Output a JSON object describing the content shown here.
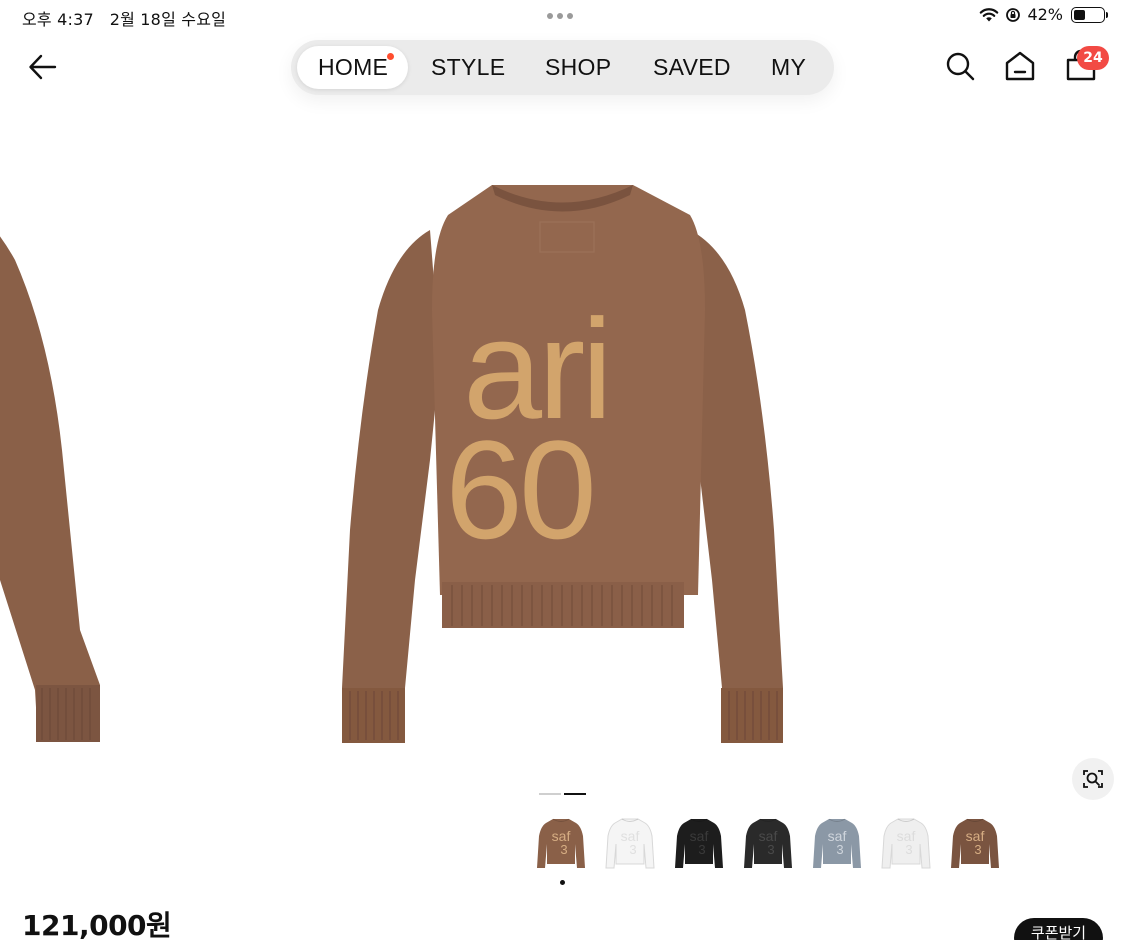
{
  "status_bar": {
    "time": "오후 4:37",
    "date": "2월 18일 수요일",
    "battery": "42%",
    "battery_level": 0.42
  },
  "nav": {
    "tabs": [
      {
        "label": "HOME",
        "active": true,
        "has_dot": true
      },
      {
        "label": "STYLE"
      },
      {
        "label": "SHOP"
      },
      {
        "label": "SAVED"
      },
      {
        "label": "MY"
      }
    ],
    "cart_count": "24",
    "icons": [
      "back-arrow-icon",
      "search-icon",
      "home-icon",
      "shopping-bag-icon"
    ]
  },
  "product": {
    "main_image_graphic": {
      "line1": "ari",
      "line2": "60"
    },
    "colors": {
      "sweater_brown": "#8a6048",
      "logo_tan": "#d2a46c"
    },
    "slide_index": 2,
    "slide_count": 2,
    "color_options": [
      {
        "body": "#8a6048",
        "text": "#d6ad83",
        "line1": "saf",
        "line2": "3"
      },
      {
        "body": "#f5f5f5",
        "text": "#e0e0e0",
        "line1": "saf",
        "line2": "3"
      },
      {
        "body": "#1d1d1d",
        "text": "#3a3a3a",
        "line1": "saf",
        "line2": "3"
      },
      {
        "body": "#2a2a2a",
        "text": "#4a4a4a",
        "line1": "saf",
        "line2": "3"
      },
      {
        "body": "#8b98a6",
        "text": "#cfd5dc",
        "line1": "saf",
        "line2": "3"
      },
      {
        "body": "#efefef",
        "text": "#dcdcdc",
        "line1": "saf",
        "line2": "3"
      },
      {
        "body": "#7a5440",
        "text": "#d6ad83",
        "line1": "saf",
        "line2": "3"
      }
    ],
    "price": "121,000원",
    "coupon_label": "쿠폰받기"
  }
}
